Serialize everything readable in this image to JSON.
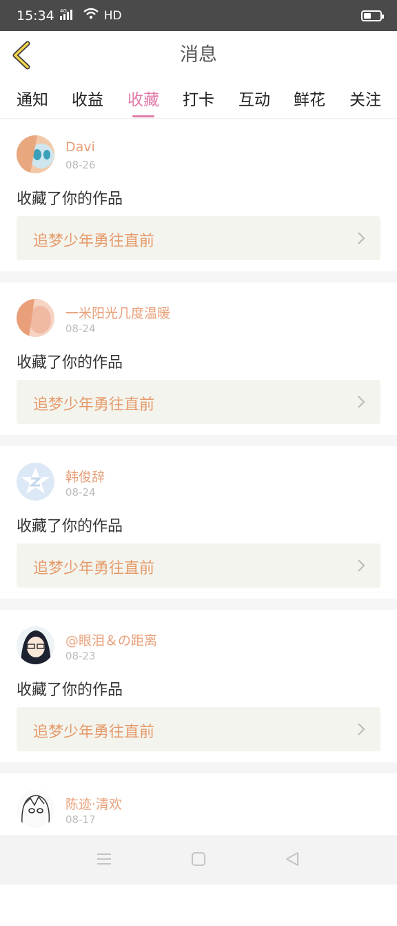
{
  "status_bar": {
    "time": "15:34",
    "network": "4G",
    "hd": "HD",
    "battery_level": 0.45
  },
  "header": {
    "title": "消息",
    "back_icon": "chevron-left-icon",
    "accent_color": "#e27aa8"
  },
  "tabs": [
    {
      "label": "通知",
      "active": false
    },
    {
      "label": "收益",
      "active": false
    },
    {
      "label": "收藏",
      "active": true
    },
    {
      "label": "打卡",
      "active": false
    },
    {
      "label": "互动",
      "active": false
    },
    {
      "label": "鲜花",
      "active": false
    },
    {
      "label": "关注",
      "active": false
    }
  ],
  "messages": [
    {
      "username": "Davi",
      "date": "08-26",
      "action": "收藏了你的作品",
      "work_title": "追梦少年勇往直前"
    },
    {
      "username": "一米阳光几度温暖",
      "date": "08-24",
      "action": "收藏了你的作品",
      "work_title": "追梦少年勇往直前"
    },
    {
      "username": "韩俊辞",
      "date": "08-24",
      "action": "收藏了你的作品",
      "work_title": "追梦少年勇往直前"
    },
    {
      "username": "@眼泪＆の距离",
      "date": "08-23",
      "action": "收藏了你的作品",
      "work_title": "追梦少年勇往直前"
    },
    {
      "username": "陈迹·清欢",
      "date": "08-17",
      "action": "",
      "work_title": ""
    }
  ],
  "nav_bar": {
    "menu_icon": "menu-icon",
    "home_icon": "home-square-icon",
    "back_icon": "back-triangle-icon"
  }
}
